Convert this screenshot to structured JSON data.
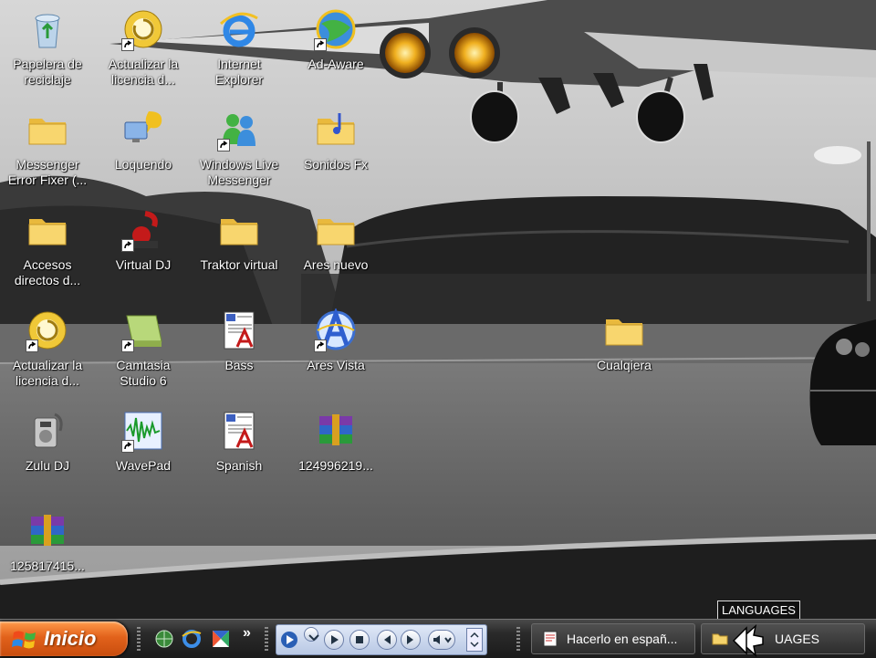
{
  "desktop": {
    "icons": [
      {
        "label": "Papelera de\nreciclaje",
        "icon": "recycle-bin-icon"
      },
      {
        "label": "Actualizar la\nlicencia d...",
        "icon": "license-update-icon"
      },
      {
        "label": "Internet\nExplorer",
        "icon": "internet-explorer-icon"
      },
      {
        "label": "Ad-Aware",
        "icon": "ad-aware-icon"
      },
      {
        "label": "Messenger\nError Fixer (...",
        "icon": "folder-icon"
      },
      {
        "label": "Loquendo",
        "icon": "loquendo-icon"
      },
      {
        "label": "Windows Live\nMessenger",
        "icon": "messenger-icon"
      },
      {
        "label": "Sonidos Fx",
        "icon": "music-folder-icon"
      },
      {
        "label": "Accesos\ndirectos d...",
        "icon": "folder-icon"
      },
      {
        "label": "Virtual DJ",
        "icon": "virtual-dj-icon"
      },
      {
        "label": "Traktor virtual",
        "icon": "folder-icon"
      },
      {
        "label": "Ares nuevo",
        "icon": "folder-icon"
      },
      {
        "label": "Actualizar la\nlicencia d...",
        "icon": "license-update-icon"
      },
      {
        "label": "Camtasia\nStudio 6",
        "icon": "camtasia-icon"
      },
      {
        "label": "Bass",
        "icon": "document-icon"
      },
      {
        "label": "Ares Vista",
        "icon": "ares-icon"
      },
      {
        "label": "Cualqiera",
        "icon": "folder-icon"
      },
      {
        "label": "Zulu DJ",
        "icon": "zulu-dj-icon"
      },
      {
        "label": "WavePad",
        "icon": "wavepad-icon"
      },
      {
        "label": "Spanish",
        "icon": "document-icon"
      },
      {
        "label": "124996219...",
        "icon": "winrar-archive-icon"
      },
      {
        "label": "125817415...",
        "icon": "winrar-archive-icon"
      }
    ]
  },
  "taskbar": {
    "start_label": "Inicio",
    "more_label": "»",
    "tasks": [
      {
        "label": "Hacerlo en españ...",
        "icon": "document-icon"
      },
      {
        "label": "UAGES",
        "icon": "folder-icon"
      }
    ],
    "tooltip": "LANGUAGES"
  },
  "colors": {
    "start_button": "#e2621b",
    "folder": "#f5d36b",
    "taskbar": "#2a2a2a"
  }
}
